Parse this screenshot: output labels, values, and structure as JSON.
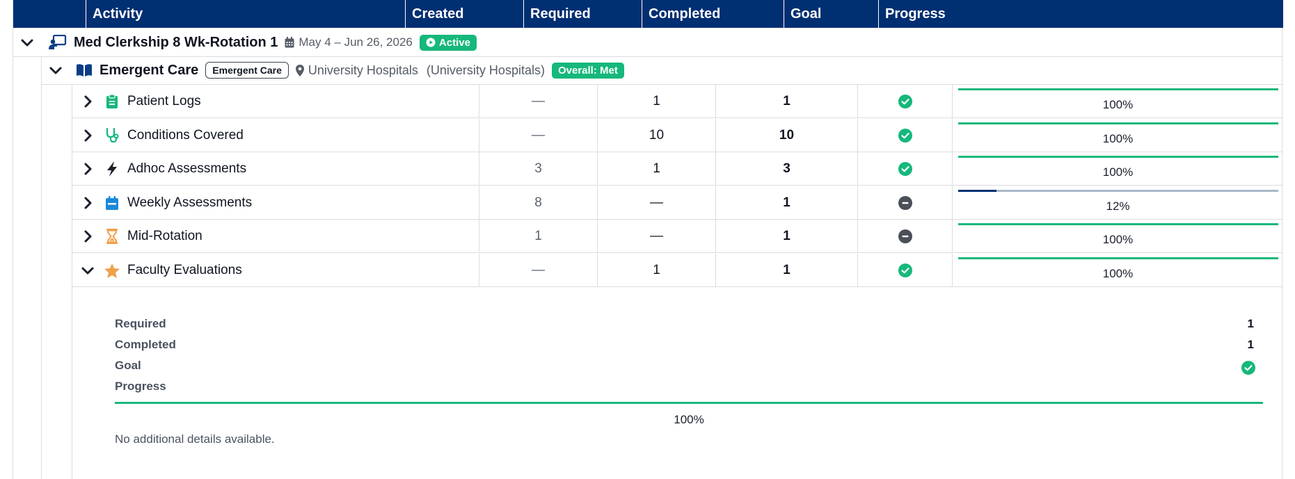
{
  "columns": {
    "activity": "Activity",
    "created": "Created",
    "required": "Required",
    "completed": "Completed",
    "goal": "Goal",
    "progress": "Progress"
  },
  "rotation": {
    "title": "Med Clerkship 8 Wk-Rotation 1",
    "dates": "May 4 – Jun 26, 2026",
    "status": "Active",
    "icon": "presentation-board-icon"
  },
  "site": {
    "title": "Emergent Care",
    "tag": "Emergent Care",
    "location": "University Hospitals",
    "location_parent": "(University Hospitals)",
    "overall": "Overall: Met",
    "icon": "book-open-icon"
  },
  "activities": [
    {
      "label": "Patient Logs",
      "icon": "clipboard-icon",
      "icon_color": "#16b87b",
      "created": "—",
      "required": "1",
      "completed": "1",
      "goal": "met",
      "progress": 1.0,
      "progress_label": "100%",
      "expanded": false
    },
    {
      "label": "Conditions Covered",
      "icon": "stethoscope-icon",
      "icon_color": "#16b87b",
      "created": "—",
      "required": "10",
      "completed": "10",
      "goal": "met",
      "progress": 1.0,
      "progress_label": "100%",
      "expanded": false
    },
    {
      "label": "Adhoc Assessments",
      "icon": "bolt-icon",
      "icon_color": "#1a1f2b",
      "created": "3",
      "required": "1",
      "completed": "3",
      "goal": "met",
      "progress": 1.0,
      "progress_label": "100%",
      "expanded": false
    },
    {
      "label": "Weekly Assessments",
      "icon": "calendar-icon",
      "icon_color": "#1a8ad8",
      "created": "8",
      "required": "—",
      "completed": "1",
      "goal": "none",
      "progress": 0.12,
      "progress_label": "12%",
      "expanded": false
    },
    {
      "label": "Mid-Rotation",
      "icon": "hourglass-icon",
      "icon_color": "#f0a04b",
      "created": "1",
      "required": "—",
      "completed": "1",
      "goal": "none",
      "progress": 1.0,
      "progress_label": "100%",
      "expanded": false
    },
    {
      "label": "Faculty Evaluations",
      "icon": "star-icon",
      "icon_color": "#f0a04b",
      "created": "—",
      "required": "1",
      "completed": "1",
      "goal": "met",
      "progress": 1.0,
      "progress_label": "100%",
      "expanded": true
    }
  ],
  "detail": {
    "required_label": "Required",
    "required_value": "1",
    "completed_label": "Completed",
    "completed_value": "1",
    "goal_label": "Goal",
    "goal": "met",
    "progress_label": "Progress",
    "progress": 1.0,
    "progress_text": "100%",
    "note": "No additional details available."
  },
  "colors": {
    "header": "#002f72",
    "met": "#16b87b",
    "neutral": "#4a4f59",
    "progress_partial": "#002f72",
    "progress_track": "#a9b7c9"
  }
}
